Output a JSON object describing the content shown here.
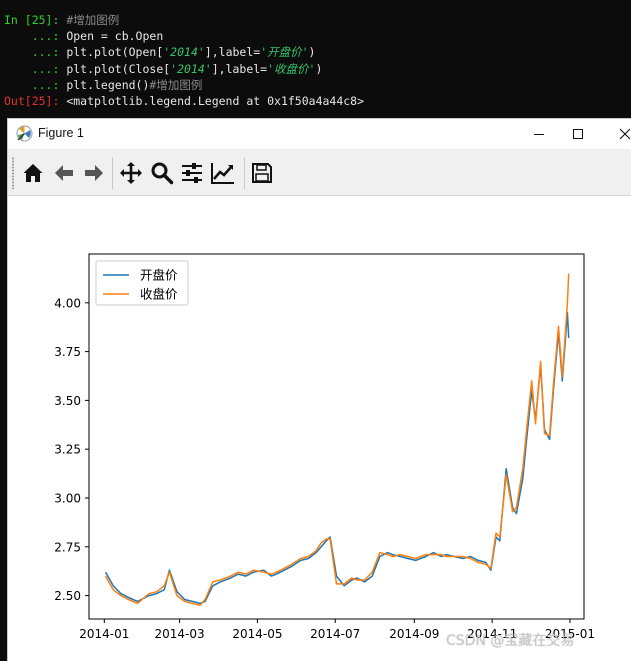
{
  "terminal": {
    "lines": [
      {
        "prompt": "In [25]:",
        "prompt_kind": "in",
        "parts": [
          {
            "t": " ",
            "k": "plain"
          },
          {
            "t": "#增加图例",
            "k": "cmt"
          }
        ]
      },
      {
        "prompt": "    ...:",
        "prompt_kind": "cont",
        "parts": [
          {
            "t": " Open = cb.Open",
            "k": "plain"
          }
        ]
      },
      {
        "prompt": "    ...:",
        "prompt_kind": "cont",
        "parts": [
          {
            "t": " plt.plot(Open[",
            "k": "plain"
          },
          {
            "t": "'2014'",
            "k": "str"
          },
          {
            "t": "],label=",
            "k": "plain"
          },
          {
            "t": "'开盘价'",
            "k": "str"
          },
          {
            "t": ")",
            "k": "plain"
          }
        ]
      },
      {
        "prompt": "    ...:",
        "prompt_kind": "cont",
        "parts": [
          {
            "t": " plt.plot(Close[",
            "k": "plain"
          },
          {
            "t": "'2014'",
            "k": "str"
          },
          {
            "t": "],label=",
            "k": "plain"
          },
          {
            "t": "'收盘价'",
            "k": "str"
          },
          {
            "t": ")",
            "k": "plain"
          }
        ]
      },
      {
        "prompt": "    ...:",
        "prompt_kind": "cont",
        "parts": [
          {
            "t": " plt.legend()",
            "k": "plain"
          },
          {
            "t": "#增加图例",
            "k": "cmt"
          }
        ]
      },
      {
        "prompt": "Out[25]:",
        "prompt_kind": "out",
        "parts": [
          {
            "t": " <matplotlib.legend.Legend at 0x1f50a4a44c8>",
            "k": "plain"
          }
        ]
      }
    ]
  },
  "window": {
    "title": "Figure 1",
    "controls": {
      "minimize": "minimize-icon",
      "maximize": "maximize-icon",
      "close": "close-icon"
    }
  },
  "toolbar": {
    "buttons": [
      "home-icon",
      "back-arrow-icon",
      "forward-arrow-icon",
      "pan-icon",
      "zoom-icon",
      "subplots-config-icon",
      "edit-axis-icon",
      "save-icon"
    ]
  },
  "watermark": "CSDN @宝藏在交易",
  "colors": {
    "series_open": "#1f77b4",
    "series_close": "#ff7f0e",
    "axis": "#000000"
  },
  "chart_data": {
    "type": "line",
    "title": "",
    "xlabel": "",
    "ylabel": "",
    "xlim": [
      "2013-12-20",
      "2015-01-12"
    ],
    "ylim": [
      2.38,
      4.25
    ],
    "grid": false,
    "legend_position": "upper-left",
    "xticks": [
      "2014-01",
      "2014-03",
      "2014-05",
      "2014-07",
      "2014-09",
      "2014-11",
      "2015-01"
    ],
    "yticks": [
      2.5,
      2.75,
      3.0,
      3.25,
      3.5,
      3.75,
      4.0
    ],
    "ytick_labels": [
      "2.50",
      "2.75",
      "3.00",
      "3.25",
      "3.50",
      "3.75",
      "4.00"
    ],
    "x": [
      "2014-01-02",
      "2014-01-08",
      "2014-01-14",
      "2014-01-20",
      "2014-01-27",
      "2014-02-05",
      "2014-02-11",
      "2014-02-17",
      "2014-02-21",
      "2014-02-27",
      "2014-03-05",
      "2014-03-11",
      "2014-03-17",
      "2014-03-21",
      "2014-03-27",
      "2014-04-02",
      "2014-04-10",
      "2014-04-16",
      "2014-04-22",
      "2014-04-28",
      "2014-05-06",
      "2014-05-12",
      "2014-05-16",
      "2014-05-22",
      "2014-05-28",
      "2014-06-04",
      "2014-06-10",
      "2014-06-16",
      "2014-06-20",
      "2014-06-24",
      "2014-06-27",
      "2014-07-02",
      "2014-07-08",
      "2014-07-14",
      "2014-07-18",
      "2014-07-24",
      "2014-07-30",
      "2014-08-05",
      "2014-08-11",
      "2014-08-15",
      "2014-08-21",
      "2014-08-27",
      "2014-09-02",
      "2014-09-10",
      "2014-09-16",
      "2014-09-22",
      "2014-09-26",
      "2014-10-09",
      "2014-10-15",
      "2014-10-21",
      "2014-10-27",
      "2014-10-31",
      "2014-11-04",
      "2014-11-07",
      "2014-11-12",
      "2014-11-17",
      "2014-11-20",
      "2014-11-25",
      "2014-11-28",
      "2014-12-02",
      "2014-12-05",
      "2014-12-09",
      "2014-12-12",
      "2014-12-16",
      "2014-12-19",
      "2014-12-23",
      "2014-12-26",
      "2014-12-30",
      "2014-12-31"
    ],
    "series": [
      {
        "name": "开盘价",
        "values": [
          2.62,
          2.55,
          2.51,
          2.49,
          2.47,
          2.5,
          2.51,
          2.53,
          2.63,
          2.52,
          2.48,
          2.47,
          2.46,
          2.47,
          2.55,
          2.57,
          2.59,
          2.61,
          2.6,
          2.62,
          2.63,
          2.6,
          2.61,
          2.63,
          2.65,
          2.68,
          2.69,
          2.72,
          2.75,
          2.78,
          2.8,
          2.6,
          2.55,
          2.58,
          2.59,
          2.57,
          2.6,
          2.7,
          2.72,
          2.71,
          2.7,
          2.69,
          2.68,
          2.7,
          2.72,
          2.7,
          2.71,
          2.69,
          2.7,
          2.68,
          2.67,
          2.63,
          2.8,
          2.78,
          3.15,
          2.95,
          2.92,
          3.1,
          3.3,
          3.55,
          3.4,
          3.68,
          3.35,
          3.3,
          3.55,
          3.85,
          3.6,
          3.95,
          3.82
        ]
      },
      {
        "name": "收盘价",
        "values": [
          2.6,
          2.53,
          2.5,
          2.48,
          2.46,
          2.51,
          2.52,
          2.55,
          2.62,
          2.5,
          2.47,
          2.46,
          2.45,
          2.48,
          2.57,
          2.58,
          2.6,
          2.62,
          2.61,
          2.63,
          2.62,
          2.61,
          2.62,
          2.64,
          2.66,
          2.69,
          2.7,
          2.73,
          2.77,
          2.79,
          2.79,
          2.56,
          2.56,
          2.59,
          2.58,
          2.58,
          2.62,
          2.72,
          2.71,
          2.7,
          2.71,
          2.7,
          2.69,
          2.71,
          2.71,
          2.71,
          2.7,
          2.7,
          2.69,
          2.67,
          2.66,
          2.64,
          2.82,
          2.8,
          3.12,
          2.93,
          2.95,
          3.15,
          3.35,
          3.6,
          3.38,
          3.7,
          3.33,
          3.32,
          3.58,
          3.88,
          3.62,
          4.0,
          4.15
        ]
      }
    ]
  }
}
